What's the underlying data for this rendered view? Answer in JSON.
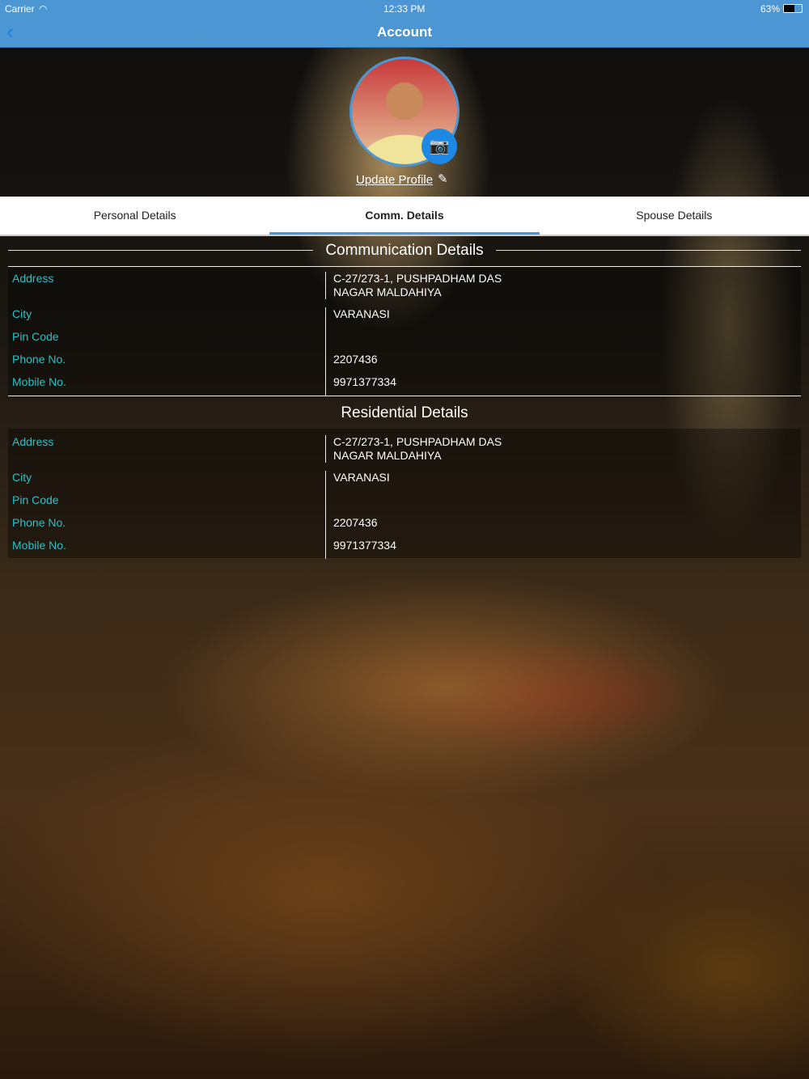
{
  "status": {
    "carrier": "Carrier",
    "time": "12:33 PM",
    "battery": "63%"
  },
  "nav": {
    "title": "Account",
    "back": "‹"
  },
  "profile": {
    "update_label": "Update Profile",
    "camera_icon": "📷",
    "edit_icon": "✎"
  },
  "tabs": [
    {
      "label": "Personal Details"
    },
    {
      "label": "Comm. Details"
    },
    {
      "label": "Spouse Details"
    }
  ],
  "communication": {
    "title": "Communication Details",
    "rows": [
      {
        "label": "Address",
        "value": "C-27/273-1, PUSHPADHAM DAS NAGAR MALDAHIYA"
      },
      {
        "label": "City",
        "value": "VARANASI"
      },
      {
        "label": "Pin Code",
        "value": ""
      },
      {
        "label": "Phone No.",
        "value": "2207436"
      },
      {
        "label": "Mobile No.",
        "value": "9971377334"
      }
    ]
  },
  "residential": {
    "title": "Residential Details",
    "rows": [
      {
        "label": "Address",
        "value": "C-27/273-1, PUSHPADHAM DAS NAGAR MALDAHIYA"
      },
      {
        "label": "City",
        "value": "VARANASI"
      },
      {
        "label": "Pin Code",
        "value": ""
      },
      {
        "label": "Phone No.",
        "value": "2207436"
      },
      {
        "label": "Mobile No.",
        "value": "9971377334"
      }
    ]
  }
}
